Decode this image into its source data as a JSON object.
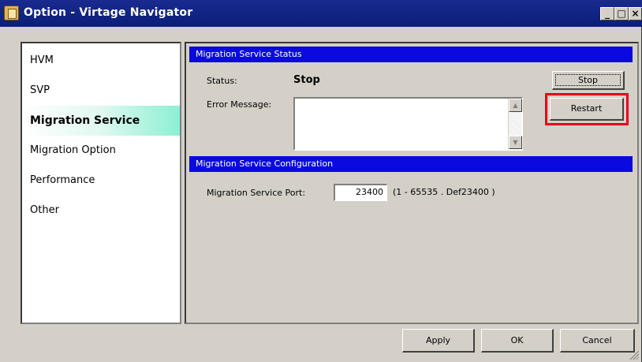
{
  "window": {
    "title": "Option - Virtage Navigator",
    "icon": "app-icon",
    "controls": {
      "minimize": "_",
      "maximize": "□",
      "close": "×"
    }
  },
  "sidebar": {
    "items": [
      {
        "label": "HVM",
        "active": false
      },
      {
        "label": "SVP",
        "active": false
      },
      {
        "label": "Migration Service",
        "active": true
      },
      {
        "label": "Migration Option",
        "active": false
      },
      {
        "label": "Performance",
        "active": false
      },
      {
        "label": "Other",
        "active": false
      }
    ]
  },
  "status_section": {
    "header": "Migration Service Status",
    "status_label": "Status:",
    "status_value": "Stop",
    "error_label": "Error Message:",
    "error_value": "",
    "stop_button": "Stop",
    "restart_button": "Restart",
    "scroll_up": "▲",
    "scroll_down": "▼"
  },
  "config_section": {
    "header": "Migration Service Configuration",
    "port_label": "Migration Service Port:",
    "port_value": "23400",
    "port_hint": "(1 - 65535 . Def23400 )"
  },
  "footer": {
    "apply_button": "Apply",
    "ok_button": "OK",
    "cancel_button": "Cancel"
  },
  "colors": {
    "titlebar": "#0a1e78",
    "section_header": "#0a0ae0",
    "highlight": "#e8001c",
    "active_item": "#8cf0d4"
  }
}
